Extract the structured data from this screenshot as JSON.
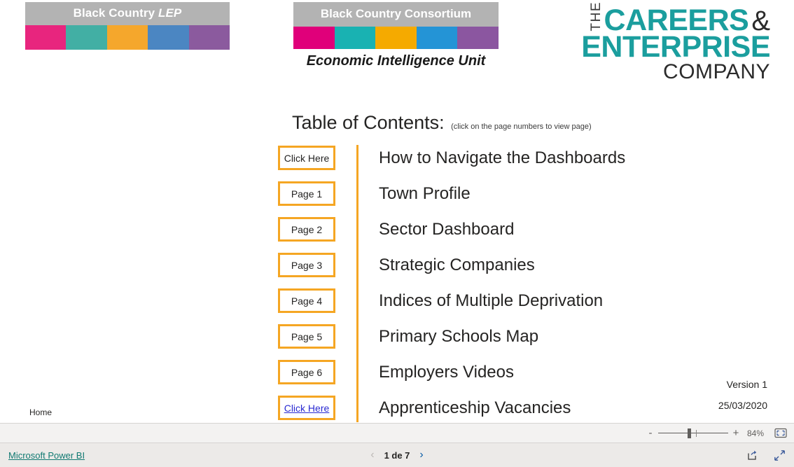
{
  "logos": {
    "lep": {
      "title_main": "Black Country",
      "title_italic": "LEP",
      "swatches": [
        "#e8257e",
        "#42afa4",
        "#f5a72c",
        "#4b86c2",
        "#8b5a9e"
      ],
      "bar_bg": "#b3b3b3"
    },
    "consortium": {
      "title": "Black Country Consortium",
      "caption": "Economic Intelligence Unit",
      "swatches": [
        "#e0007a",
        "#19b2b2",
        "#f5aa00",
        "#2494d6",
        "#8b56a0"
      ],
      "bar_bg": "#b3b3b3"
    },
    "careers": {
      "the": "THE",
      "careers": "CAREERS",
      "ampersand": "&",
      "enterprise": "ENTERPRISE",
      "company": "COMPANY",
      "accent": "#1b9e9e"
    }
  },
  "toc": {
    "title": "Table of Contents:",
    "subtitle": "(click on the page numbers to view page)",
    "accent": "#f5a623",
    "link_color": "#2a2ad1",
    "rows": [
      {
        "button": "Click Here",
        "label": "How to Navigate the Dashboards",
        "style": "plain"
      },
      {
        "button": "Page 1",
        "label": "Town Profile",
        "style": "plain"
      },
      {
        "button": "Page 2",
        "label": "Sector Dashboard",
        "style": "plain"
      },
      {
        "button": "Page 3",
        "label": "Strategic Companies",
        "style": "plain"
      },
      {
        "button": "Page 4",
        "label": "Indices of Multiple Deprivation",
        "style": "plain"
      },
      {
        "button": "Page 5",
        "label": "Primary Schools Map",
        "style": "plain"
      },
      {
        "button": "Page 6",
        "label": "Employers Videos",
        "style": "plain"
      },
      {
        "button": "Click Here",
        "label": "Apprenticeship Vacancies",
        "style": "link"
      }
    ]
  },
  "version": {
    "label": "Version 1",
    "date": "25/03/2020"
  },
  "home_label": "Home",
  "zoombar": {
    "minus": "-",
    "plus": "+",
    "percent": "84%",
    "fit_icon": "fit-to-page-icon"
  },
  "footer": {
    "powerbi_label": "Microsoft Power BI",
    "prev_icon": "chevron-left-icon",
    "next_icon": "chevron-right-icon",
    "page_indicator": "1 de 7",
    "share_icon": "share-icon",
    "fullscreen_icon": "fullscreen-icon"
  }
}
